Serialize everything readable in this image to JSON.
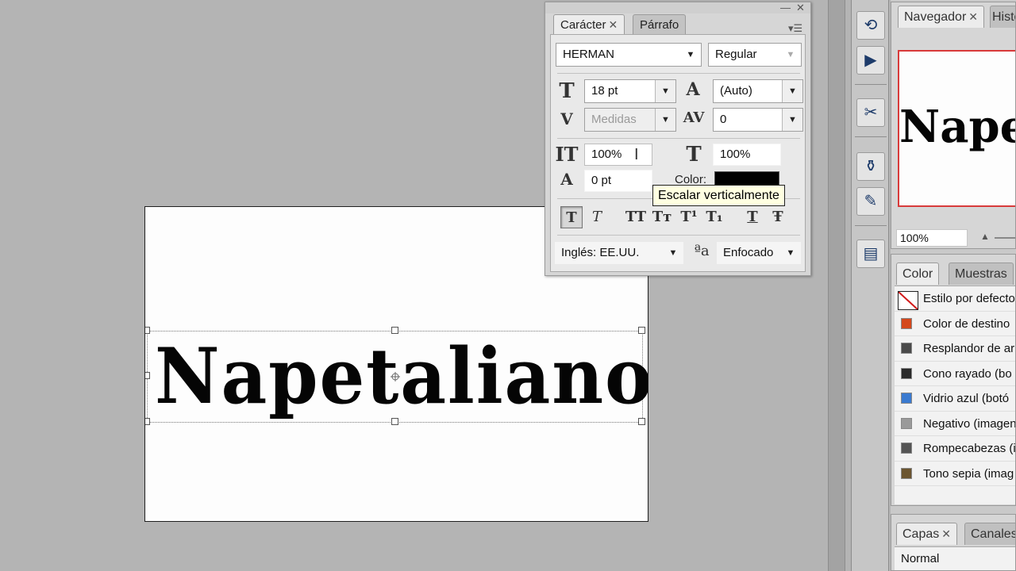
{
  "canvas": {
    "artwork_text": "Napetaliano"
  },
  "char_panel": {
    "collapse_glyph": "««",
    "minimize_glyph": "—",
    "close_glyph": "✕",
    "tabs": [
      {
        "label": "Carácter",
        "active": true
      },
      {
        "label": "Párrafo",
        "active": false
      }
    ],
    "tab_close_glyph": "✕",
    "menu_glyph": "▾☰",
    "font_family": "HERMAN",
    "font_style": "Regular",
    "size": "18 pt",
    "leading": "(Auto)",
    "kerning": "Medidas",
    "tracking": "0",
    "vertical_scale": "100%",
    "horizontal_scale": "100%",
    "baseline_shift": "0 pt",
    "color_label": "Color:",
    "color_value": "#000000",
    "style_buttons": [
      {
        "glyph": "T",
        "name": "faux-bold"
      },
      {
        "glyph": "T",
        "name": "faux-italic"
      },
      {
        "glyph": "TT",
        "name": "all-caps"
      },
      {
        "glyph": "Tт",
        "name": "small-caps"
      },
      {
        "glyph": "T¹",
        "name": "superscript"
      },
      {
        "glyph": "T₁",
        "name": "subscript"
      },
      {
        "glyph": "T",
        "name": "underline"
      },
      {
        "glyph": "Ŧ",
        "name": "strikethrough"
      }
    ],
    "language": "Inglés: EE.UU.",
    "aa_icon_text": "ªa",
    "antialias": "Enfocado",
    "dropdown_glyph": "▼",
    "icon_text": {
      "size": "T",
      "leading": "A",
      "kerning": "V",
      "tracking": "AV",
      "vscale": "IT",
      "hscale": "T",
      "baseline": "A"
    }
  },
  "tooltip": "Escalar verticalmente",
  "navigator_panel": {
    "tab_label": "Navegador",
    "tab2_label": "Histo",
    "close_glyph": "✕",
    "preview_text": "Napetaliano",
    "zoom": "100%"
  },
  "styles_panel": {
    "tab_color": "Color",
    "tab_swatches": "Muestras",
    "items": [
      {
        "label": "Estilo por defecto",
        "swatch": "#ffffff"
      },
      {
        "label": "Color de destino",
        "swatch": "#d4481c"
      },
      {
        "label": "Resplandor de ar",
        "swatch": "#4a4a4a"
      },
      {
        "label": "Cono rayado (bo",
        "swatch": "#2a2a2a"
      },
      {
        "label": "Vidrio azul (botó",
        "swatch": "#3a7ad0"
      },
      {
        "label": "Negativo (imagen",
        "swatch": "#9a9a9a"
      },
      {
        "label": "Rompecabezas (i",
        "swatch": "#555555"
      },
      {
        "label": "Tono sepia (imag",
        "swatch": "#6b5530"
      }
    ]
  },
  "layers_panel": {
    "tab_layers": "Capas",
    "tab_channels": "Canales",
    "close_glyph": "✕",
    "blend_mode": "Normal"
  },
  "side_icons": [
    {
      "name": "history-icon",
      "glyph": "⟲"
    },
    {
      "name": "actions-icon",
      "glyph": "▶"
    },
    {
      "name": "tools-presets-icon",
      "glyph": "✂"
    },
    {
      "name": "clone-source-icon",
      "glyph": "⚱"
    },
    {
      "name": "brush-presets-icon",
      "glyph": "✎"
    },
    {
      "name": "notes-icon",
      "glyph": "▤"
    }
  ]
}
